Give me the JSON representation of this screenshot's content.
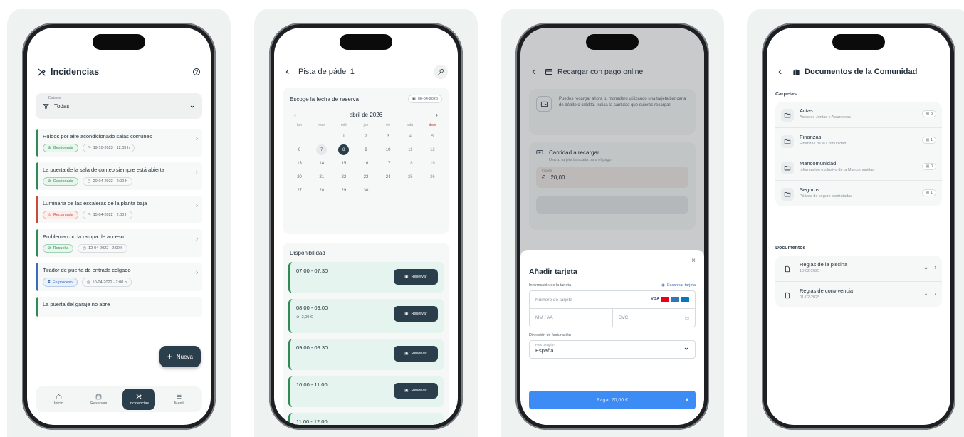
{
  "screen1": {
    "title": "Incidencias",
    "filter_label": "Estado",
    "filter_value": "Todas",
    "incidents": [
      {
        "title": "Ruidos por aire acondicionado salas comunes",
        "status": "Gestionada",
        "status_kind": "g",
        "date": "19-10-2023 · 12:05 h"
      },
      {
        "title": "La puerta de la sala de conteo siempre está abierta",
        "status": "Gestionada",
        "status_kind": "g",
        "date": "20-04-2022 · 2:00 h"
      },
      {
        "title": "Luminaria de las escaleras de la planta baja",
        "status": "Reclamada",
        "status_kind": "r",
        "date": "15-04-2022 · 2:00 h"
      },
      {
        "title": "Problema con la rampa de acceso",
        "status": "Resuelta",
        "status_kind": "g",
        "date": "12-04-2022 · 2:00 h"
      },
      {
        "title": "Tirador de puerta de entrada colgado",
        "status": "En proceso",
        "status_kind": "b",
        "date": "10-04-2022 · 2:00 h"
      },
      {
        "title": "La puerta del garaje no abre",
        "status": "",
        "status_kind": "",
        "date": ""
      }
    ],
    "fab_label": "Nueva",
    "nav": [
      {
        "label": "Inicio",
        "icon": "home-icon"
      },
      {
        "label": "Reservas",
        "icon": "calendar-icon"
      },
      {
        "label": "Incidencias",
        "icon": "tools-icon"
      },
      {
        "label": "Menú",
        "icon": "menu-icon"
      }
    ]
  },
  "screen2": {
    "title": "Pista de pádel 1",
    "date_prompt": "Escoge la fecha de reserva",
    "date_value": "08-04-2026",
    "month": "abril de 2026",
    "weekdays": [
      "lun",
      "mar",
      "mié",
      "jue",
      "vie",
      "sáb",
      "dom"
    ],
    "weeks": [
      [
        "",
        "",
        "1",
        "2",
        "3",
        "4",
        "5"
      ],
      [
        "6",
        "7",
        "8",
        "9",
        "10",
        "11",
        "12"
      ],
      [
        "13",
        "14",
        "15",
        "16",
        "17",
        "18",
        "19"
      ],
      [
        "20",
        "21",
        "22",
        "23",
        "24",
        "25",
        "26"
      ],
      [
        "27",
        "28",
        "29",
        "30",
        "",
        "",
        ""
      ]
    ],
    "today": "7",
    "selected": "8",
    "availability_title": "Disponibilidad",
    "slots": [
      {
        "time": "07:00 - 07:30",
        "price": ""
      },
      {
        "time": "08:00 - 09:00",
        "price": "2,00 €"
      },
      {
        "time": "09:00 - 09:30",
        "price": ""
      },
      {
        "time": "10:00 - 11:00",
        "price": ""
      },
      {
        "time": "11:00 - 12:00",
        "price": ""
      }
    ],
    "reserve_label": "Reservar"
  },
  "screen3": {
    "title": "Recargar con pago online",
    "info_text": "Puedes recargar ahora tu monedero utilizando una tarjeta bancaria de débito o crédito. Indica la cantidad que quieres recargar.",
    "amount_title": "Cantidad a recargar",
    "amount_sub": "Usa tu tarjeta bancaria para el pago",
    "amount_label": "Importe",
    "currency": "€",
    "amount_value": "20,00",
    "sheet_title": "Añadir tarjeta",
    "card_info_label": "Información de la tarjeta",
    "scan_label": "Escanear tarjeta",
    "card_number_placeholder": "Número de tarjeta",
    "expiry_placeholder": "MM / AA",
    "cvc_placeholder": "CVC",
    "billing_label": "Dirección de facturación",
    "country_label": "País o región",
    "country_value": "España",
    "pay_label": "Pagar 20,00 €"
  },
  "screen4": {
    "title": "Documentos de la Comunidad",
    "folders_title": "Carpetas",
    "folders": [
      {
        "name": "Actas",
        "desc": "Actas de Juntas y Asambleas",
        "count": "3"
      },
      {
        "name": "Finanzas",
        "desc": "Finanzas de la Comunidad",
        "count": "1"
      },
      {
        "name": "Mancomunidad",
        "desc": "Información exclusiva de la Mancomunidad",
        "count": "0"
      },
      {
        "name": "Seguros",
        "desc": "Pólizas de seguro contratadas",
        "count": "1"
      }
    ],
    "documents_title": "Documentos",
    "documents": [
      {
        "name": "Reglas de la piscina",
        "date": "10-02-2025"
      },
      {
        "name": "Reglas de convivencia",
        "date": "01-02-2025"
      }
    ]
  },
  "colors": {
    "primary": "#2b3e4c",
    "green": "#2f8a55",
    "red": "#c84c3c",
    "blue": "#3d6bb6",
    "pay_blue": "#3d8bf5"
  }
}
